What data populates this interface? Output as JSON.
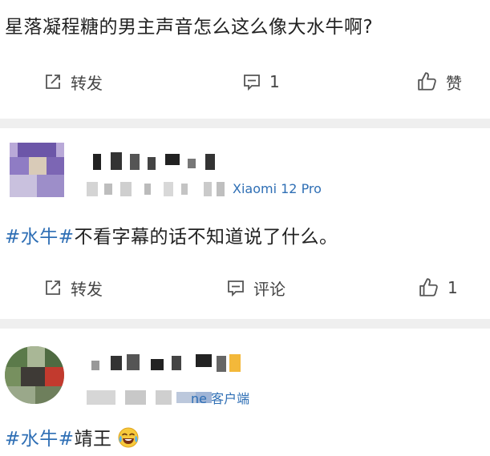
{
  "post1": {
    "text": "星落凝程糖的男主声音怎么这么像大水牛啊?",
    "actions": {
      "repost": "转发",
      "comment_count": "1",
      "like": "赞"
    }
  },
  "comment1": {
    "device": "Xiaomi 12 Pro",
    "topic": "#水牛#",
    "text": "不看字幕的话不知道说了什么。",
    "actions": {
      "repost": "转发",
      "comment": "评论",
      "like_count": "1"
    }
  },
  "comment2": {
    "device": "ne 客户端",
    "topic": "#水牛#",
    "text": "靖王",
    "emoji": "laughing-tears-emoji"
  },
  "colors": {
    "topic": "#2f6fb5",
    "separator": "#efefef",
    "text": "#222222"
  }
}
